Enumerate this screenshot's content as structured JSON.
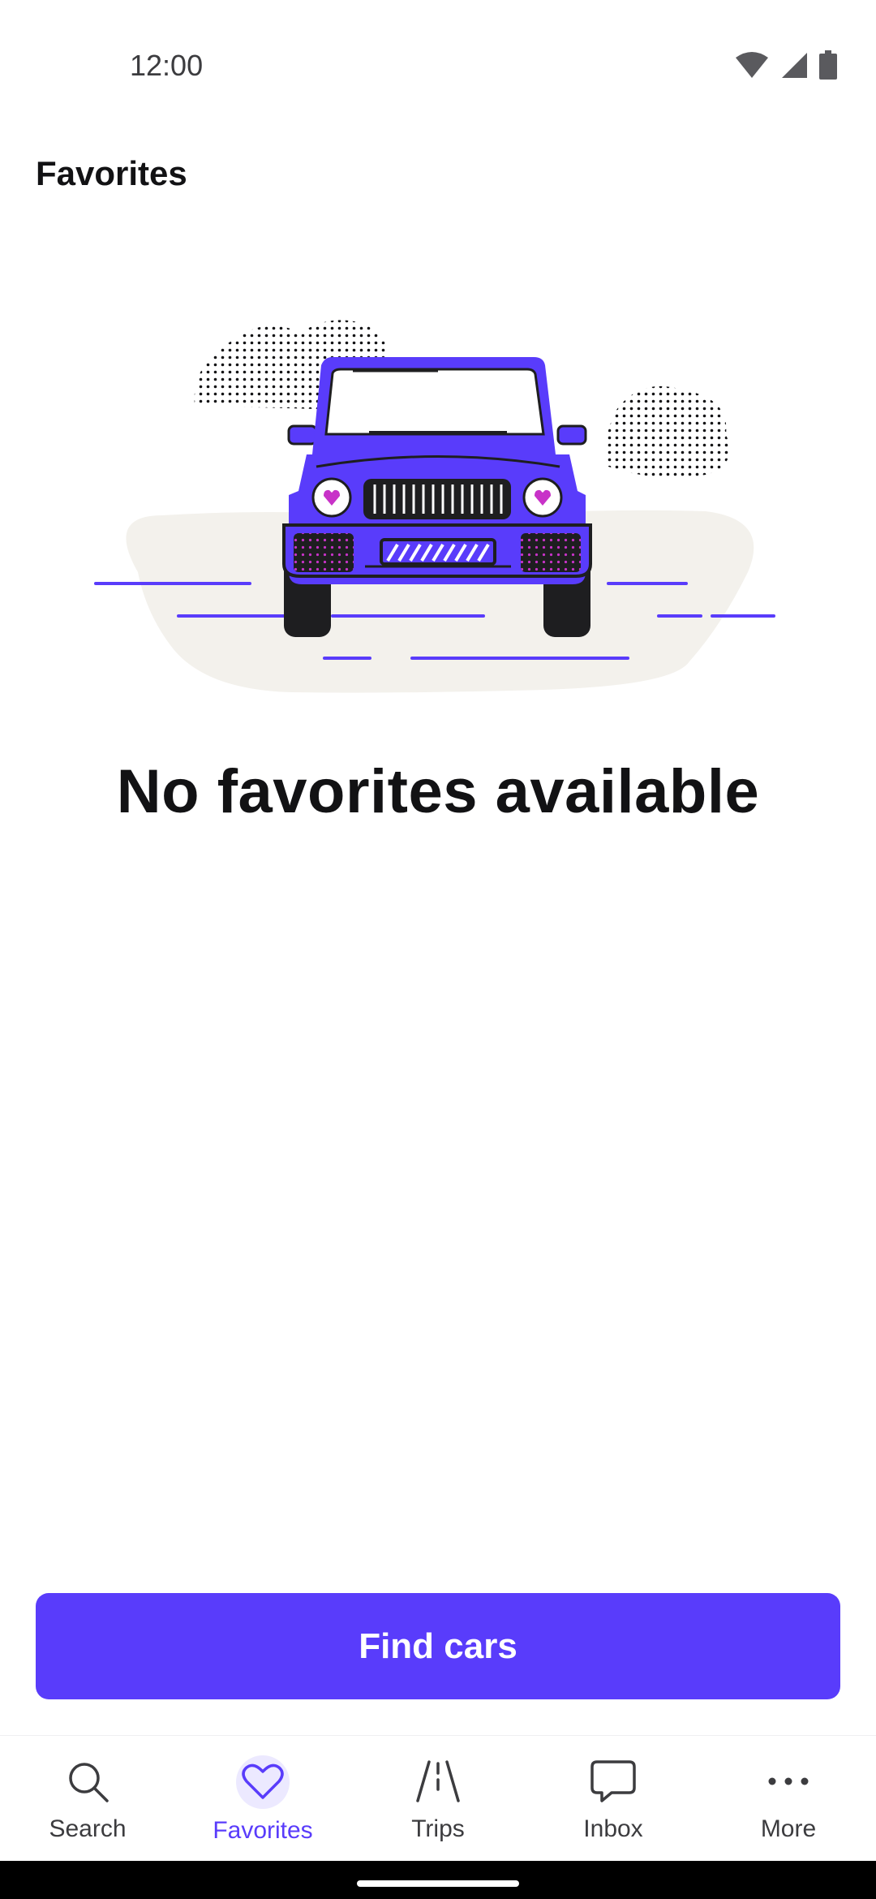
{
  "status_bar": {
    "time": "12:00",
    "icons": [
      "wifi-icon",
      "cellular-icon",
      "battery-icon"
    ]
  },
  "header": {
    "title": "Favorites"
  },
  "empty_state": {
    "title": "No favorites available",
    "illustration": "jeep-with-hearts"
  },
  "cta": {
    "label": "Find cars"
  },
  "bottom_nav": {
    "items": [
      {
        "label": "Search",
        "icon": "search-icon",
        "active": false
      },
      {
        "label": "Favorites",
        "icon": "heart-icon",
        "active": true
      },
      {
        "label": "Trips",
        "icon": "road-icon",
        "active": false
      },
      {
        "label": "Inbox",
        "icon": "chat-bubble-icon",
        "active": false
      },
      {
        "label": "More",
        "icon": "more-dots-icon",
        "active": false
      }
    ]
  },
  "colors": {
    "accent": "#593cfb",
    "text": "#121214",
    "muted": "#3c3c3f",
    "active_bg": "#ece9ff",
    "heart_pink": "#c832c8",
    "blob": "#f3f1ec"
  }
}
